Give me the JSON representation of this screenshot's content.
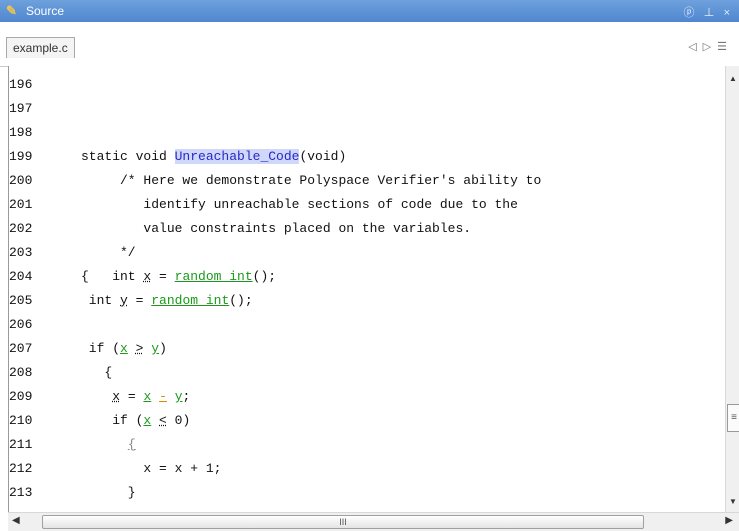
{
  "window": {
    "title": "Source",
    "controls": "ⓟ ⊥ ×"
  },
  "tabs": [
    {
      "label": "example.c"
    }
  ],
  "tab_nav": {
    "prev": "◁",
    "next": "▷",
    "menu": "☰"
  },
  "lines": [
    {
      "num": "196",
      "code": ""
    },
    {
      "num": "197",
      "code": ""
    },
    {
      "num": "198",
      "code": ""
    },
    {
      "num": "199",
      "code": ""
    },
    {
      "num": "200",
      "code": "     /* Here we demonstrate Polyspace Verifier's ability to"
    },
    {
      "num": "201",
      "code": "        identify unreachable sections of code due to the"
    },
    {
      "num": "202",
      "code": "        value constraints placed on the variables."
    },
    {
      "num": "203",
      "code": "     */"
    },
    {
      "num": "204",
      "code": ""
    },
    {
      "num": "205",
      "code": ""
    },
    {
      "num": "206",
      "code": ""
    },
    {
      "num": "207",
      "code": ""
    },
    {
      "num": "208",
      "code": "   {"
    },
    {
      "num": "209",
      "code": ""
    },
    {
      "num": "210",
      "code": ""
    },
    {
      "num": "211",
      "code": ""
    },
    {
      "num": "212",
      "code": "        x = x + 1;"
    },
    {
      "num": "213",
      "code": "      }"
    }
  ],
  "tokens": {
    "l199_a": "static void ",
    "l199_fn": "Unreachable_Code",
    "l199_b": "(void)",
    "l204_a": "{   int ",
    "l204_x": "x",
    "l204_b": " = ",
    "l204_call": "random_int",
    "l204_c": "();",
    "l205_a": " int ",
    "l205_y": "y",
    "l205_b": " = ",
    "l205_call": "random_int",
    "l205_c": "();",
    "l207_a": " if (",
    "l207_x": "x",
    "l207_sp": " ",
    "l207_op": ">",
    "l207_sp2": " ",
    "l207_y": "y",
    "l207_b": ")",
    "l209_a": "    ",
    "l209_x": "x",
    "l209_b": " = ",
    "l209_x2": "x",
    "l209_sp": " ",
    "l209_minus": "-",
    "l209_sp2": " ",
    "l209_y": "y",
    "l209_c": ";",
    "l210_a": "    if (",
    "l210_x": "x",
    "l210_sp": " ",
    "l210_op": "<",
    "l210_b": " 0)",
    "l211_a": "      ",
    "l211_brace": "{"
  },
  "scrollbars": {
    "vertical_grip": "≡",
    "horizontal_grip": "III"
  }
}
